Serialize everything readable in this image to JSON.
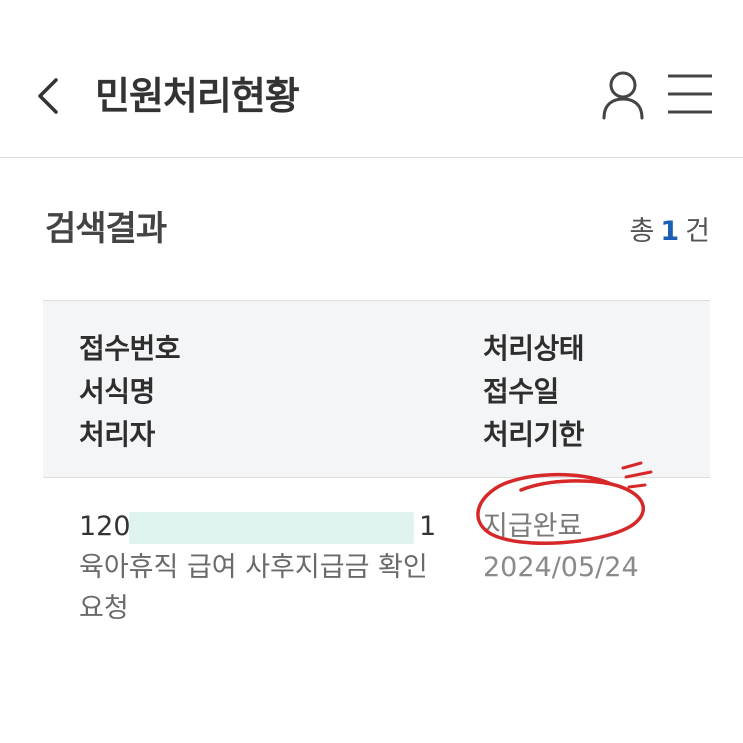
{
  "header": {
    "title": "민원처리현황"
  },
  "results": {
    "title": "검색결과",
    "count_prefix": "총",
    "count": "1",
    "count_suffix": "건"
  },
  "table": {
    "headers_left": [
      "접수번호",
      "서식명",
      "처리자"
    ],
    "headers_right": [
      "처리상태",
      "접수일",
      "처리기한"
    ],
    "rows": [
      {
        "receipt_no_start": "120",
        "receipt_no_end": "1",
        "form_name": "육아휴직 급여 사후지급금 확인 요청",
        "status": "지급완료",
        "received_date": "2024/05/24"
      }
    ]
  },
  "colors": {
    "count_accent": "#1a5fb4",
    "annotation": "#d62828"
  }
}
